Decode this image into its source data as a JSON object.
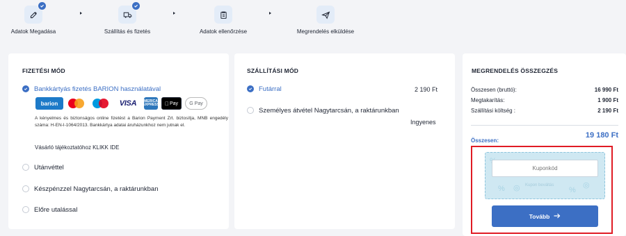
{
  "stepper": {
    "steps": [
      {
        "label": "Adatok Megadása",
        "done": true,
        "icon": "edit-icon"
      },
      {
        "label": "Szállítás és fizetés",
        "done": true,
        "icon": "truck-icon"
      },
      {
        "label": "Adatok ellenőrzése",
        "done": false,
        "icon": "clipboard-icon"
      },
      {
        "label": "Megrendelés elküldése",
        "done": false,
        "icon": "send-icon"
      }
    ]
  },
  "payment": {
    "title": "FIZETÉSI MÓD",
    "options": [
      {
        "label": "Bankkártyás fizetés BARION használatával",
        "selected": true
      },
      {
        "label": "Utánvéttel",
        "selected": false
      },
      {
        "label": "Készpénzzel Nagytarcsán, a raktárunkban",
        "selected": false
      },
      {
        "label": "Előre utalással",
        "selected": false
      }
    ],
    "logos": {
      "barion": "barion",
      "visa": "VISA",
      "amex_top": "AMERICAN",
      "amex_bottom": "EXPRESS",
      "apple": "Pay",
      "gpay": "G Pay"
    },
    "disclaimer": "A kényelmes és biztonságos online fizetést a Barion Payment Zrt. biztosítja, MNB engedély száma: H-EN-I-1064/2013. Bankkártya adatai áruházunkhoz nem jutnak el.",
    "barion_link": "Vásárló tájékoztatóhoz KLIKK IDE"
  },
  "shipping": {
    "title": "SZÁLLÍTÁSI MÓD",
    "options": [
      {
        "label": "Futárral",
        "price": "2 190 Ft",
        "selected": true
      },
      {
        "label": "Személyes átvétel Nagytarcsán, a raktárunkban",
        "price": "Ingyenes",
        "selected": false
      }
    ]
  },
  "summary": {
    "title": "MEGRENDELÉS ÖSSZEGZÉS",
    "rows": [
      {
        "label": "Összesen (bruttó):",
        "value": "16 990 Ft"
      },
      {
        "label": "Megtakarítás:",
        "value": "1 900 Ft"
      },
      {
        "label": "Szállítási költség :",
        "value": "2 190 Ft"
      }
    ],
    "total_label": "Összesen:",
    "total_value": "19 180 Ft",
    "coupon_placeholder": "Kuponkód",
    "coupon_hint": "Kupon beváltás",
    "next_label": "Tovább",
    "accent": "#3c6fc4",
    "highlight_color": "#e01b24"
  }
}
